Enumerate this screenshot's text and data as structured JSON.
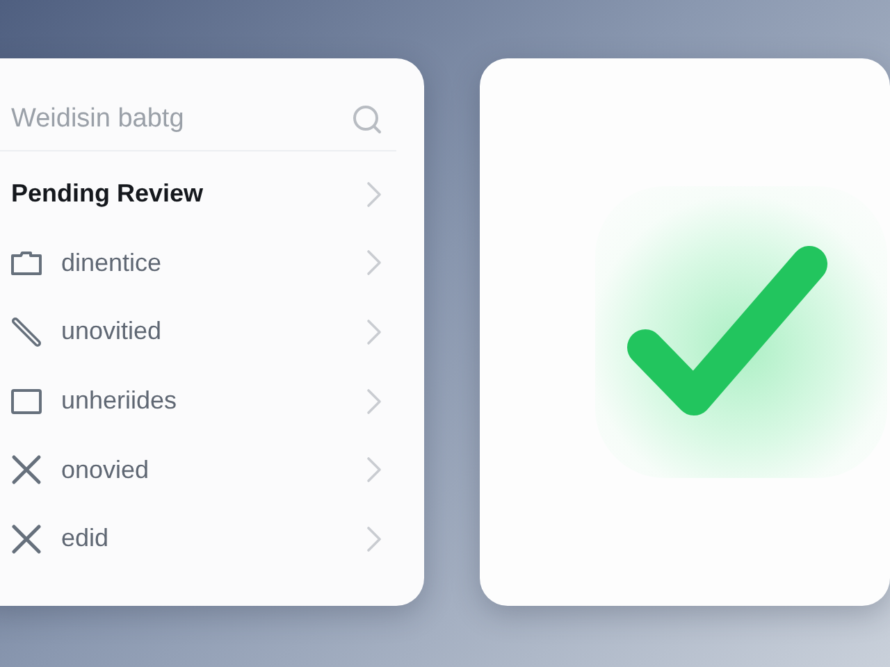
{
  "search": {
    "placeholder": "Weidisin babtg"
  },
  "list": [
    {
      "kind": "heading",
      "label": "Pending Review"
    },
    {
      "kind": "folder",
      "label": "dinentice"
    },
    {
      "kind": "pin",
      "label": "unovitied"
    },
    {
      "kind": "square",
      "label": "unheriides"
    },
    {
      "kind": "cross",
      "label": "onovied"
    },
    {
      "kind": "cross",
      "label": "edid"
    }
  ],
  "status": {
    "kind": "success"
  }
}
